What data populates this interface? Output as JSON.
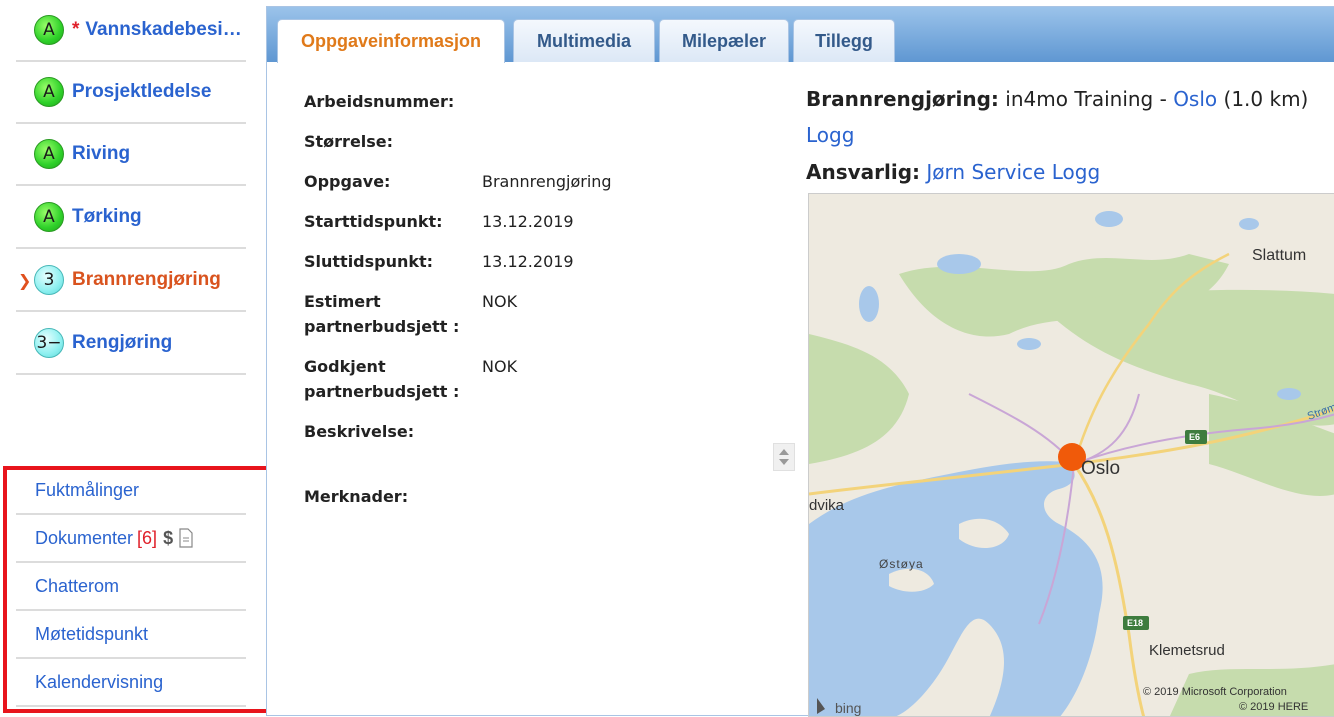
{
  "sidebar": {
    "tasks": [
      {
        "badge": "A",
        "label": "Vannskadebesiktigelse",
        "star": "*"
      },
      {
        "badge": "A",
        "label": "Prosjektledelse"
      },
      {
        "badge": "A",
        "label": "Riving"
      },
      {
        "badge": "A",
        "label": "Tørking"
      },
      {
        "badge": "3",
        "label": "Brannrengjøring",
        "active": true
      },
      {
        "badge": "3−",
        "label": "Rengjøring"
      }
    ],
    "links": [
      {
        "label": "Fuktmålinger"
      },
      {
        "label": "Dokumenter",
        "count": "[6]",
        "dollar": "$"
      },
      {
        "label": "Chatterom"
      },
      {
        "label": "Møtetidspunkt"
      },
      {
        "label": "Kalendervisning"
      }
    ]
  },
  "tabs": [
    {
      "label": "Oppgaveinformasjon",
      "active": true
    },
    {
      "label": "Multimedia"
    },
    {
      "label": "Milepæler"
    },
    {
      "label": "Tillegg"
    }
  ],
  "fields": [
    {
      "label": "Arbeidsnummer:",
      "value": ""
    },
    {
      "label": "Størrelse:",
      "value": ""
    },
    {
      "label": "Oppgave:",
      "value": "Brannrengjøring"
    },
    {
      "label": "Starttidspunkt:",
      "value": "13.12.2019"
    },
    {
      "label": "Sluttidspunkt:",
      "value": "13.12.2019"
    },
    {
      "label_line1": "Estimert",
      "label_line2": "partnerbudsjett :",
      "value": "NOK"
    },
    {
      "label_line1": "Godkjent",
      "label_line2": "partnerbudsjett :",
      "value": "NOK"
    },
    {
      "label": "Beskrivelse:",
      "value": ""
    },
    {
      "label": "Merknader:",
      "value": ""
    }
  ],
  "info": {
    "task_label": "Brannrengjøring:",
    "company": "in4mo Training -",
    "city_link": "Oslo",
    "distance": "(1.0 km)",
    "log_link": "Logg",
    "responsible_label": "Ansvarlig:",
    "responsible_link": "Jørn Service Logg"
  },
  "map": {
    "labels": {
      "slattum": "Slattum",
      "oslo": "Oslo",
      "dvika": "dvika",
      "ostoya": "Østøya",
      "klemetsrud": "Klemetsrud",
      "e6": "E6",
      "e18": "E18",
      "strom": "Strøm",
      "bing": "bing",
      "copyright1": "© 2019 Microsoft Corporation",
      "copyright2": "© 2019 HERE"
    },
    "colors": {
      "water": "#a8c8ea",
      "forest": "#c6dcad",
      "land": "#eeeae0",
      "marker": "#f05a0a"
    }
  }
}
